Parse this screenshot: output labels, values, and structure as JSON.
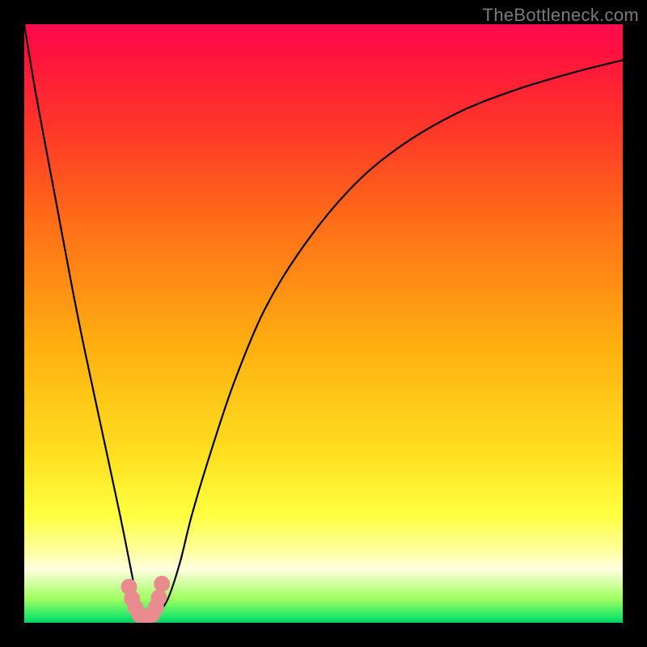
{
  "watermark": {
    "text": "TheBottleneck.com"
  },
  "chart_data": {
    "type": "line",
    "title": "",
    "xlabel": "",
    "ylabel": "",
    "xlim": [
      0,
      100
    ],
    "ylim": [
      0,
      100
    ],
    "grid": false,
    "series": [
      {
        "name": "bottleneck-curve",
        "x": [
          0,
          2,
          5,
          8,
          10,
          13,
          16,
          18,
          19,
          20,
          21,
          22,
          24,
          26,
          28,
          31,
          35,
          40,
          46,
          54,
          62,
          72,
          82,
          92,
          100
        ],
        "y": [
          100,
          88,
          72,
          56,
          46,
          32,
          18,
          8,
          3,
          1,
          0,
          1,
          4,
          10,
          18,
          28,
          40,
          52,
          62,
          72,
          79,
          85,
          89,
          92,
          94
        ]
      }
    ],
    "markers": {
      "color": "#e98b8f",
      "points": [
        {
          "x": 17.5,
          "y": 6
        },
        {
          "x": 18.0,
          "y": 4
        },
        {
          "x": 18.6,
          "y": 2.5
        },
        {
          "x": 19.3,
          "y": 1.3
        },
        {
          "x": 20.3,
          "y": 0.8
        },
        {
          "x": 21.4,
          "y": 1.4
        },
        {
          "x": 22.0,
          "y": 2.6
        },
        {
          "x": 22.5,
          "y": 4.2
        },
        {
          "x": 23.0,
          "y": 6.5
        }
      ]
    },
    "background_gradient": {
      "top": "#ff0b50",
      "mid_upper": "#ff6a18",
      "mid": "#ffe020",
      "mid_lower": "#ffffa0",
      "bottom": "#00d060"
    }
  }
}
